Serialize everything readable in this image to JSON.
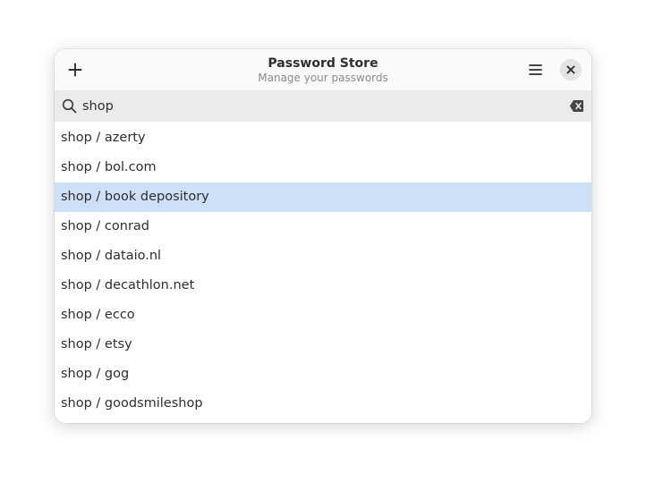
{
  "header": {
    "title": "Password Store",
    "subtitle": "Manage your passwords",
    "add_icon": "plus-icon",
    "menu_icon": "hamburger-menu-icon",
    "close_icon": "close-icon"
  },
  "search": {
    "value": "shop",
    "search_icon": "magnifier-icon",
    "clear_icon": "backspace-clear-icon"
  },
  "colors": {
    "selected_row": "#cde0f7",
    "search_background": "#ebebeb",
    "header_background": "#fafafa"
  },
  "list": {
    "selected_index": 2,
    "items": [
      "shop / azerty",
      "shop / bol.com",
      "shop / book depository",
      "shop / conrad",
      "shop / dataio.nl",
      "shop / decathlon.net",
      "shop / ecco",
      "shop / etsy",
      "shop / gog",
      "shop / goodsmileshop"
    ]
  }
}
